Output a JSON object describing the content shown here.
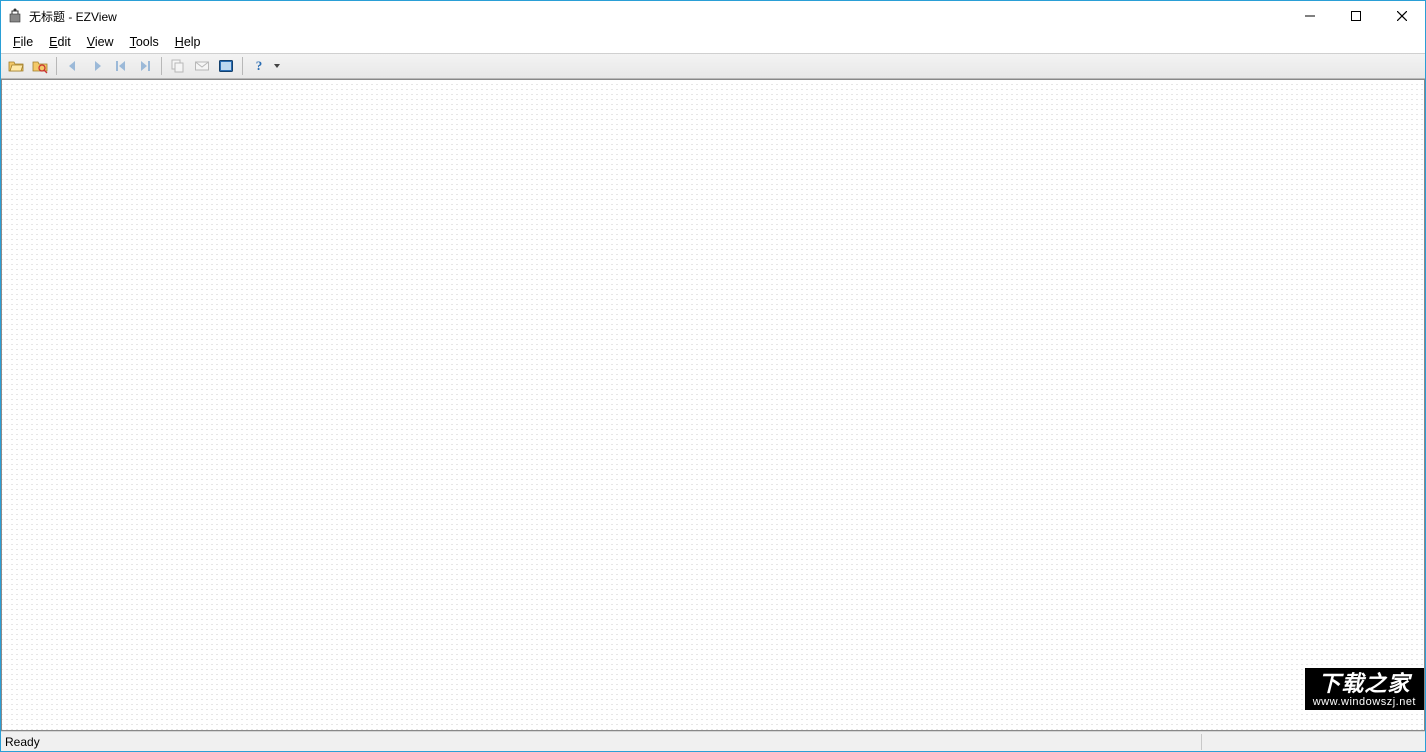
{
  "titlebar": {
    "title": "无标题 - EZView"
  },
  "menubar": {
    "items": [
      {
        "label": "File",
        "key": "F"
      },
      {
        "label": "Edit",
        "key": "E"
      },
      {
        "label": "View",
        "key": "V"
      },
      {
        "label": "Tools",
        "key": "T"
      },
      {
        "label": "Help",
        "key": "H"
      }
    ]
  },
  "toolbar": {
    "buttons": [
      {
        "name": "open-icon",
        "enabled": true
      },
      {
        "name": "browse-icon",
        "enabled": true
      },
      {
        "sep": true
      },
      {
        "name": "nav-back-icon",
        "enabled": false
      },
      {
        "name": "nav-forward-icon",
        "enabled": false
      },
      {
        "name": "nav-first-icon",
        "enabled": false
      },
      {
        "name": "nav-last-icon",
        "enabled": false
      },
      {
        "sep": true
      },
      {
        "name": "copy-icon",
        "enabled": false
      },
      {
        "name": "mail-icon",
        "enabled": false
      },
      {
        "name": "fullscreen-icon",
        "enabled": true
      },
      {
        "sep": true
      },
      {
        "name": "help-icon",
        "enabled": true,
        "dropdown": true
      }
    ]
  },
  "statusbar": {
    "text": "Ready"
  },
  "watermark": {
    "big": "下载之家",
    "small": "www.windowszj.net"
  }
}
